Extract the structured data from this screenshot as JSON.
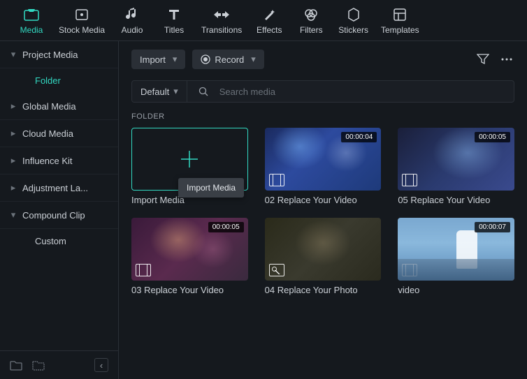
{
  "tabs": [
    {
      "label": "Media",
      "icon": "media"
    },
    {
      "label": "Stock Media",
      "icon": "stock"
    },
    {
      "label": "Audio",
      "icon": "audio"
    },
    {
      "label": "Titles",
      "icon": "titles"
    },
    {
      "label": "Transitions",
      "icon": "transitions"
    },
    {
      "label": "Effects",
      "icon": "effects"
    },
    {
      "label": "Filters",
      "icon": "filters"
    },
    {
      "label": "Stickers",
      "icon": "stickers"
    },
    {
      "label": "Templates",
      "icon": "templates"
    }
  ],
  "sidebar": {
    "items": [
      {
        "label": "Project Media",
        "expanded": true,
        "sub": "Folder"
      },
      {
        "label": "Global Media"
      },
      {
        "label": "Cloud Media"
      },
      {
        "label": "Influence Kit"
      },
      {
        "label": "Adjustment La..."
      },
      {
        "label": "Compound Clip",
        "expanded": true,
        "sub": "Custom",
        "subNormal": true
      }
    ]
  },
  "toolbar": {
    "import_label": "Import",
    "record_label": "Record"
  },
  "search": {
    "sort_label": "Default",
    "placeholder": "Search media"
  },
  "section_title": "FOLDER",
  "tooltip": "Import Media",
  "cards": [
    {
      "label": "Import Media",
      "type": "import"
    },
    {
      "label": "02 Replace Your Video",
      "duration": "00:00:04",
      "type": "video",
      "thumb": "concert"
    },
    {
      "label": "05 Replace Your Video",
      "duration": "00:00:05",
      "type": "video",
      "thumb": "singer"
    },
    {
      "label": "03 Replace Your Video",
      "duration": "00:00:05",
      "type": "video",
      "thumb": "party"
    },
    {
      "label": "04 Replace Your Photo",
      "type": "image",
      "thumb": "photo"
    },
    {
      "label": "video",
      "duration": "00:00:07",
      "type": "video",
      "thumb": "beach"
    }
  ]
}
